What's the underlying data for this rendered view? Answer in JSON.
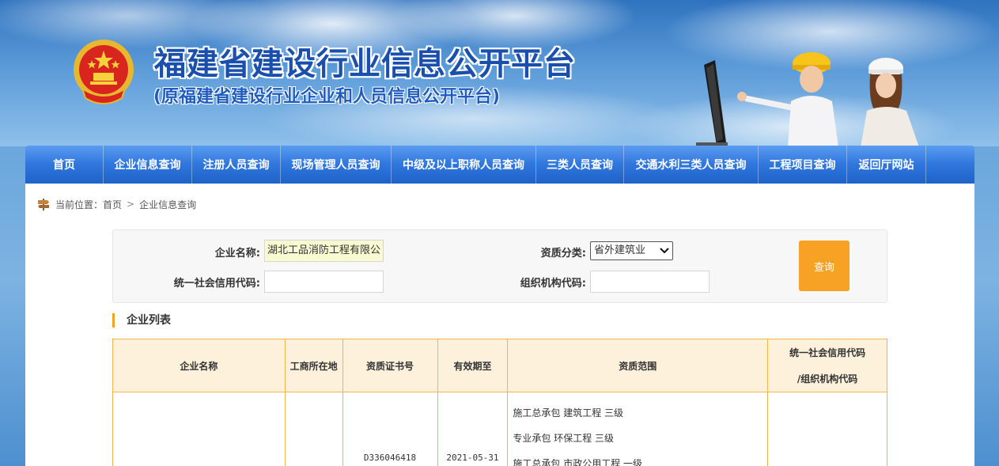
{
  "header": {
    "title": "福建省建设行业信息公开平台",
    "subtitle": "(原福建省建设行业企业和人员信息公开平台)"
  },
  "nav": {
    "items": [
      {
        "label": "首页"
      },
      {
        "label": "企业信息查询"
      },
      {
        "label": "注册人员查询"
      },
      {
        "label": "现场管理人员查询"
      },
      {
        "label": "中级及以上职称人员查询"
      },
      {
        "label": "三类人员查询"
      },
      {
        "label": "交通水利三类人员查询"
      },
      {
        "label": "工程项目查询"
      },
      {
        "label": "返回厅网站"
      }
    ]
  },
  "breadcrumb": {
    "prefix": "当前位置：",
    "home": "首页",
    "separator": ">",
    "current": "企业信息查询"
  },
  "search": {
    "company_name_label": "企业名称:",
    "company_name_value": "湖北工品消防工程有限公",
    "qualification_label": "资质分类:",
    "qualification_selected": "省外建筑业",
    "credit_code_label": "统一社会信用代码:",
    "credit_code_value": "",
    "org_code_label": "组织机构代码:",
    "org_code_value": "",
    "query_button": "查询"
  },
  "list": {
    "title": "企业列表",
    "columns": {
      "name": "企业名称",
      "location": "工商所在地",
      "cert_no": "资质证书号",
      "valid_until": "有效期至",
      "scope": "资质范围",
      "code_line1": "统一社会信用代码",
      "code_line2": "/组织机构代码"
    },
    "rows": [
      {
        "name": "",
        "location": "",
        "cert_no": "D336046418",
        "valid_until": "2021-05-31",
        "scope": [
          "施工总承包 建筑工程 三级",
          "专业承包 环保工程 三级",
          "施工总承包 市政公用工程 一级"
        ],
        "code": ""
      }
    ]
  },
  "colors": {
    "nav_blue": "#2f76dd",
    "accent_orange": "#f7a224",
    "table_border": "#f3b44a",
    "title_blue": "#1a4fae"
  }
}
